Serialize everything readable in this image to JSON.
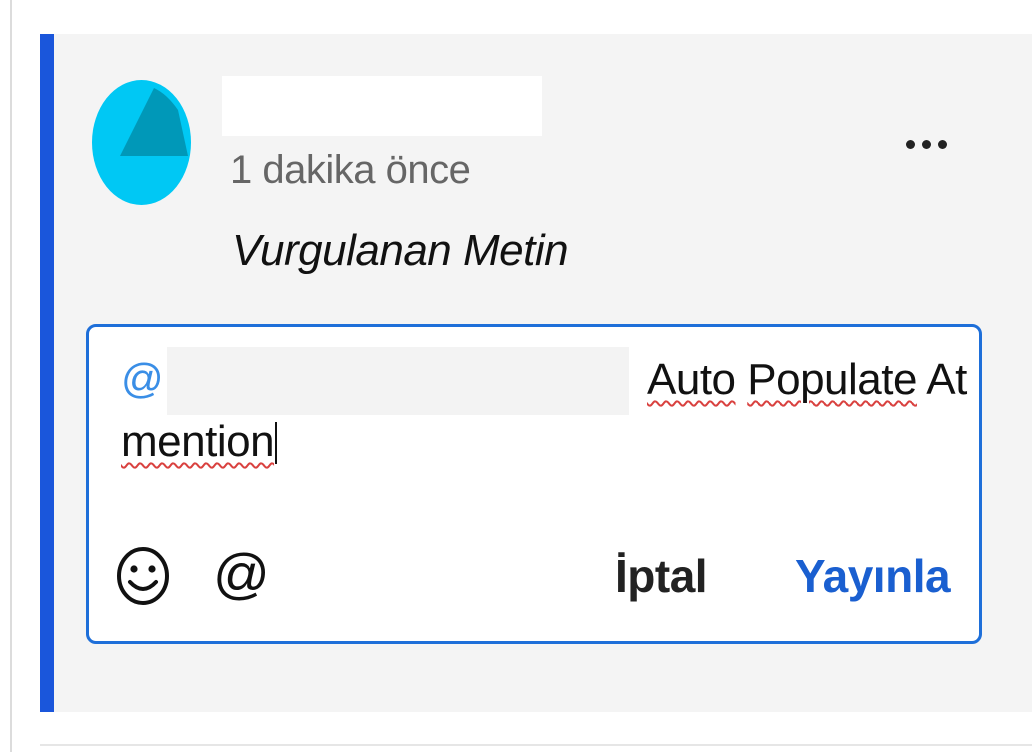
{
  "comment": {
    "timestamp": "1 dakika önce",
    "highlighted_text": "Vurgulanan Metin",
    "more_options_icon": "ellipsis-icon"
  },
  "reply": {
    "mention_prefix": "@",
    "text_line1": "Auto Populate At",
    "text_line1_word1": "Auto",
    "text_line1_word2": "Populate",
    "text_line1_word3": "At",
    "text_line2": "mention",
    "toolbar": {
      "emoji_icon": "smiley-icon",
      "mention_icon": "@",
      "cancel_label": "İptal",
      "publish_label": "Yayınla"
    }
  },
  "colors": {
    "accent": "#1a56db",
    "editor_border": "#1e6fd9",
    "mention": "#3a8ee6",
    "publish": "#1a5fd0",
    "avatar": "#00c8f4",
    "avatar_shape": "#0098b8",
    "card_background": "#f4f4f4"
  }
}
